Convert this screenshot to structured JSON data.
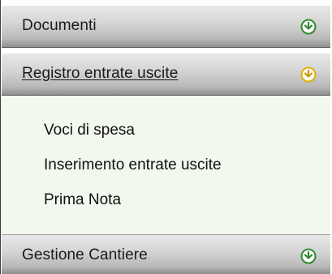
{
  "menu": {
    "sections": [
      {
        "label": "Documenti",
        "toggle_icon": "expand-arrow-icon",
        "state": "collapsed",
        "icon_color": "#2e8b2e"
      },
      {
        "label": "Registro entrate uscite",
        "toggle_icon": "collapse-arrow-icon",
        "state": "expanded",
        "icon_color": "#e0b000"
      },
      {
        "label": "Gestione Cantiere",
        "toggle_icon": "expand-arrow-icon",
        "state": "collapsed",
        "icon_color": "#2e8b2e"
      }
    ],
    "submenu": [
      {
        "label": "Voci di spesa"
      },
      {
        "label": "Inserimento entrate uscite"
      },
      {
        "label": "Prima Nota"
      }
    ]
  }
}
